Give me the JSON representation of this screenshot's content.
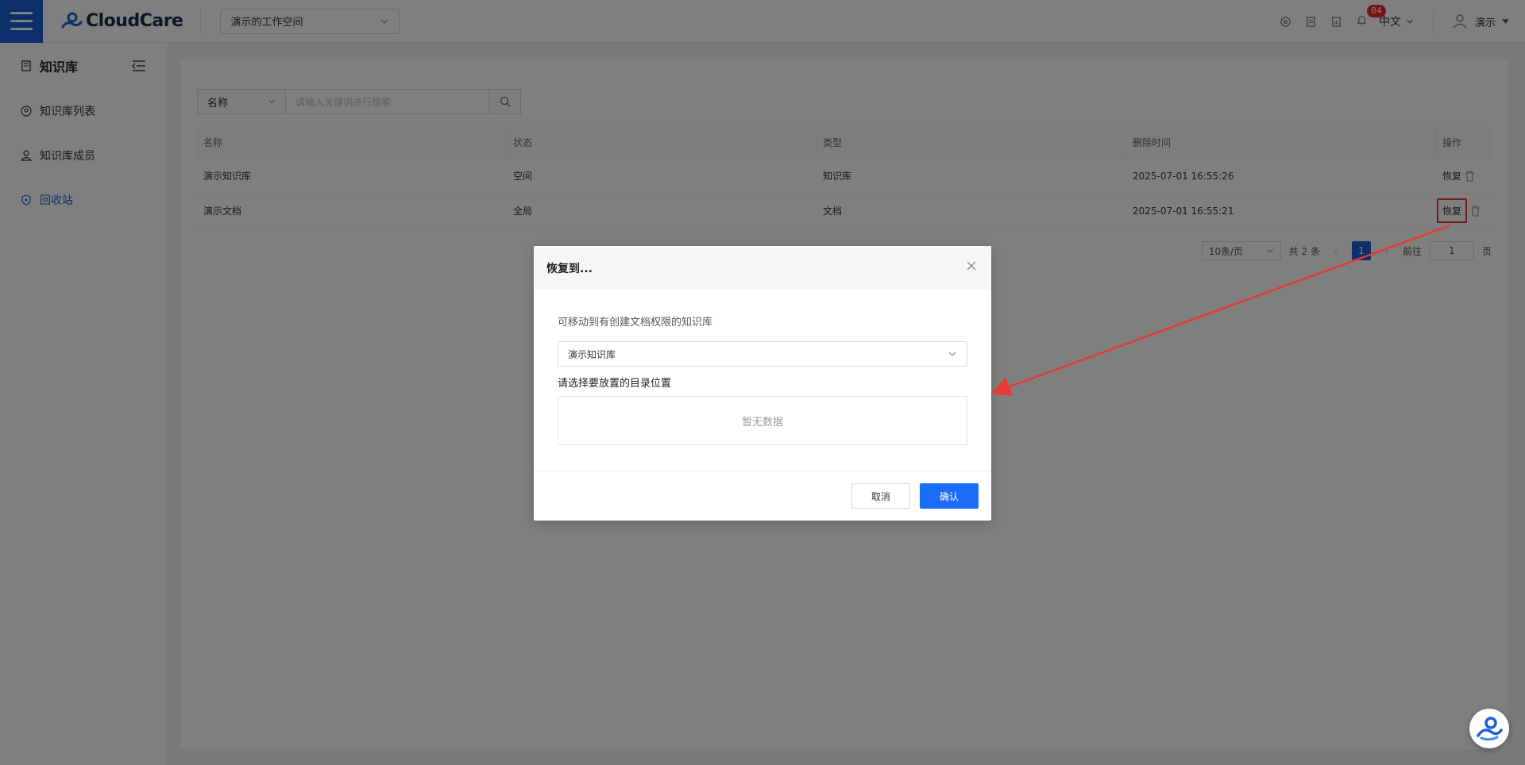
{
  "app": {
    "brand": "CloudCare",
    "workspace": "演示的工作空间",
    "notification_count": "84",
    "language": "中文",
    "user": "演示"
  },
  "sidebar": {
    "title": "知识库",
    "items": [
      {
        "label": "知识库列表"
      },
      {
        "label": "知识库成员"
      },
      {
        "label": "回收站"
      }
    ]
  },
  "search": {
    "field": "名称",
    "placeholder": "请输入关键词进行搜索"
  },
  "table": {
    "headers": [
      "名称",
      "状态",
      "类型",
      "删除时间",
      "操作"
    ],
    "rows": [
      {
        "name": "演示知识库",
        "status": "空间",
        "type": "知识库",
        "deleted_at": "2025-07-01 16:55:26",
        "action": "恢复"
      },
      {
        "name": "演示文档",
        "status": "全局",
        "type": "文档",
        "deleted_at": "2025-07-01 16:55:21",
        "action": "恢复"
      }
    ]
  },
  "pagination": {
    "page_size": "10条/页",
    "total": "共 2 条",
    "current": "1",
    "goto_label": "前往",
    "goto_value": "1",
    "page_suffix": "页"
  },
  "modal": {
    "title": "恢复到...",
    "hint": "可移动到有创建文档权限的知识库",
    "selected_kb": "演示知识库",
    "dir_label": "请选择要放置的目录位置",
    "empty": "暂无数据",
    "cancel": "取消",
    "confirm": "确认"
  },
  "colors": {
    "primary": "#1b5fd6",
    "confirm": "#1b6cf6",
    "highlight": "#e53935",
    "badge": "#f5222d"
  }
}
